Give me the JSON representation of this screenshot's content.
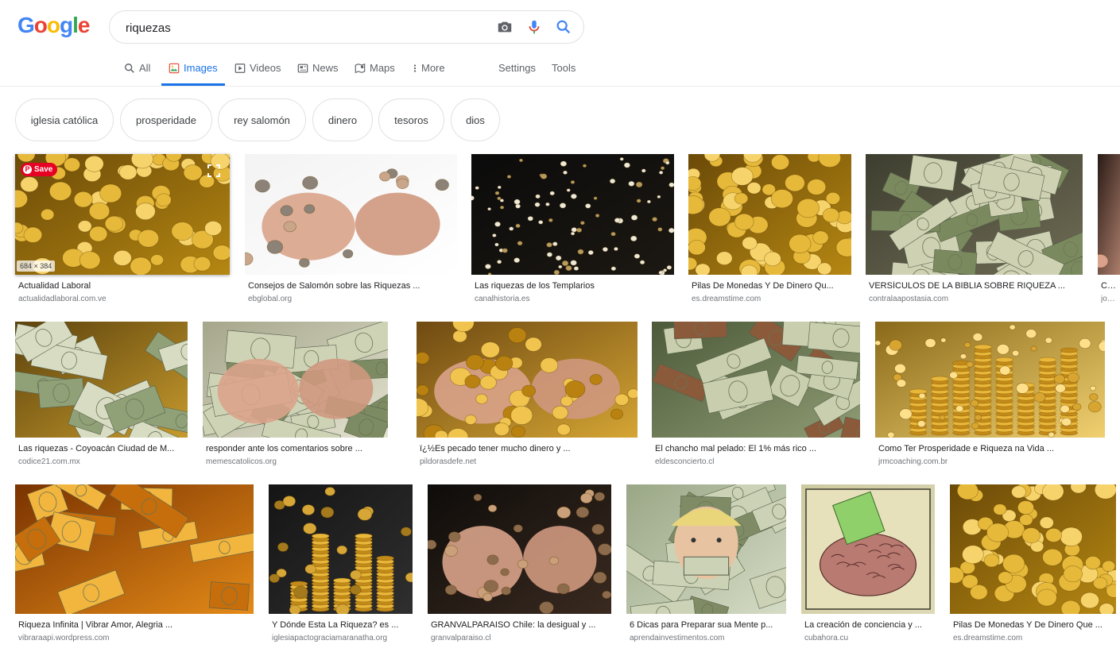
{
  "logo": {
    "letters": [
      "G",
      "o",
      "o",
      "g",
      "l",
      "e"
    ],
    "colors": [
      "#4285f4",
      "#ea4335",
      "#fbbc05",
      "#4285f4",
      "#34a853",
      "#ea4335"
    ]
  },
  "search": {
    "query": "riquezas",
    "icons": [
      "camera-icon",
      "microphone-icon",
      "search-icon"
    ]
  },
  "nav": {
    "items": [
      {
        "label": "All",
        "icon": "search-icon"
      },
      {
        "label": "Images",
        "icon": "image-icon",
        "active": true
      },
      {
        "label": "Videos",
        "icon": "play-icon"
      },
      {
        "label": "News",
        "icon": "news-icon"
      },
      {
        "label": "Maps",
        "icon": "map-icon"
      },
      {
        "label": "More",
        "icon": "more-vert-icon"
      }
    ],
    "settings": "Settings",
    "tools": "Tools"
  },
  "chips": [
    "iglesia católica",
    "prosperidade",
    "rey salomón",
    "dinero",
    "tesoros",
    "dios"
  ],
  "hover": {
    "save_label": "Save",
    "dimensions": "684 × 384"
  },
  "results": [
    {
      "title": "Actualidad Laboral",
      "domain": "actualidadlaboral.com.ve",
      "theme": "gold-coins"
    },
    {
      "title": "Consejos de Salomón sobre las Riquezas ...",
      "domain": "ebglobal.org",
      "theme": "hands-plant"
    },
    {
      "title": "Las riquezas de los Templarios",
      "domain": "canalhistoria.es",
      "theme": "pearls"
    },
    {
      "title": "Pilas De Monedas Y De Dinero Qu...",
      "domain": "es.dreamstime.com",
      "theme": "gold-coins"
    },
    {
      "title": "VERSÍCULOS DE LA BIBLIA SOBRE RIQUEZA ...",
      "domain": "contralaapostasia.com",
      "theme": "cash-stacks"
    },
    {
      "title": "Cóm",
      "domain": "josefo",
      "theme": "hand"
    },
    {
      "title": "Las riquezas - Coyoacán Ciudad de M...",
      "domain": "codice21.com.mx",
      "theme": "dollar-fan"
    },
    {
      "title": "responder ante los comentarios sobre ...",
      "domain": "memescatolicos.org",
      "theme": "hands-dollars"
    },
    {
      "title": "ï¿½Es pecado tener mucho dinero y ...",
      "domain": "pildorasdefe.net",
      "theme": "hands-gold"
    },
    {
      "title": "El chancho mal pelado: El 1% más rico ...",
      "domain": "eldesconcierto.cl",
      "theme": "dollars-coins"
    },
    {
      "title": "Como Ter Prosperidade e Riqueza na Vida ...",
      "domain": "jrmcoaching.com.br",
      "theme": "coin-towers"
    },
    {
      "title": "Riqueza Infinita | Vibrar Amor, Alegria ...",
      "domain": "vibraraapi.wordpress.com",
      "theme": "gold-bars"
    },
    {
      "title": "Y Dónde Esta La Riqueza? es ...",
      "domain": "iglesiapactograciamaranatha.org",
      "theme": "suit-coins"
    },
    {
      "title": "GRANVALPARAISO Chile: la desigual y ...",
      "domain": "granvalparaiso.cl",
      "theme": "hands-coins-dark"
    },
    {
      "title": "6 Dicas para Preparar sua Mente p...",
      "domain": "aprendainvestimentos.com",
      "theme": "woman-dollars"
    },
    {
      "title": "La creación de conciencia y ...",
      "domain": "cubahora.cu",
      "theme": "brain"
    },
    {
      "title": "Pilas De Monedas Y De Dinero Que ...",
      "domain": "es.dreamstime.com",
      "theme": "gold-coins"
    }
  ]
}
